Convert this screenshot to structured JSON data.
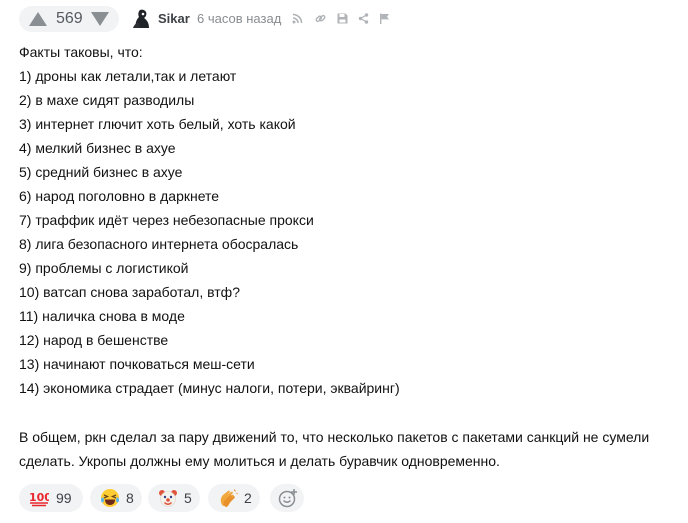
{
  "comment": {
    "votes": "569",
    "author": "Sikar",
    "timestamp": "6 часов назад",
    "action_icons": [
      "rss-icon",
      "link-icon",
      "save-icon",
      "share-icon",
      "flag-icon"
    ],
    "intro": "Факты таковы, что:",
    "facts": [
      "1) дроны как летали,так и летают",
      "2) в махе сидят разводилы",
      "3) интернет глючит хоть белый, хоть какой",
      "4) мелкий бизнес в ахуе",
      "5) средний бизнес в ахуе",
      "6) народ поголовно в даркнете",
      "7) траффик идёт через небезопасные прокси",
      "8) лига безопасного интернета обосралась",
      "9) проблемы с логистикой",
      "10) ватсап снова заработал, втф?",
      "11) наличка снова в моде",
      "12) народ в бешенстве",
      "13) начинают почковаться меш-сети",
      "14) экономика страдает (минус налоги, потери, эквайринг)"
    ],
    "conclusion_line1": "В общем, ркн сделал за пару движений то, что несколько пакетов с пакетами санкций не сумели",
    "conclusion_line2": "сделать. Укропы должны ему молиться и делать буравчик одновременно."
  },
  "reactions": [
    {
      "icon": "hundred-points-icon",
      "count": "99"
    },
    {
      "icon": "rolling-laughing-icon",
      "count": "8"
    },
    {
      "icon": "clown-face-icon",
      "count": "5"
    },
    {
      "icon": "clapping-hands-icon",
      "count": "2"
    }
  ],
  "colors": {
    "text": "#111111",
    "muted": "#888d92",
    "pill_background": "#f2f3f5",
    "icon": "#8a8f94"
  }
}
